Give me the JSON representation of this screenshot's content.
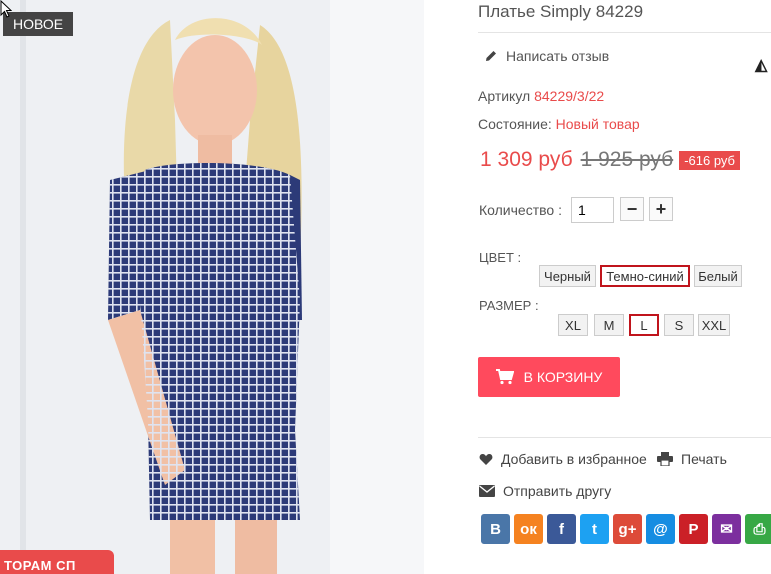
{
  "product": {
    "badge_new": "НОВОЕ",
    "promo_text": "ТОРАМ СП",
    "title": "Платье Simply 84229",
    "review_link": "Написать отзыв",
    "sku_label": "Артикул",
    "sku_value": "84229/3/22",
    "condition_label": "Состояние:",
    "condition_value": "Новый товар",
    "price_new": "1 309 руб",
    "price_old": "1 925 руб",
    "discount": "-616 руб",
    "qty_label": "Количество :",
    "qty_value": "1",
    "minus": "−",
    "plus": "+"
  },
  "options": {
    "color_label": "ЦВЕТ :",
    "colors": [
      "Черный",
      "Темно-синий",
      "Белый"
    ],
    "selected_color": "Темно-синий",
    "size_label": "РАЗМЕР :",
    "sizes": [
      "XL",
      "M",
      "L",
      "S",
      "XXL"
    ],
    "selected_size": "L"
  },
  "actions": {
    "cart_label": "В КОРЗИНУ",
    "wishlist_label": "Добавить в избранное",
    "print_label": "Печать",
    "send_friend_label": "Отправить другу"
  },
  "share": {
    "buttons": [
      {
        "icon": "vk-icon",
        "glyph": "В",
        "color": "#4a76a8"
      },
      {
        "icon": "odnoklassniki-icon",
        "glyph": "ок",
        "color": "#f58220"
      },
      {
        "icon": "facebook-icon",
        "glyph": "f",
        "color": "#3b5998"
      },
      {
        "icon": "twitter-icon",
        "glyph": "t",
        "color": "#1da1f2"
      },
      {
        "icon": "google-plus-icon",
        "glyph": "g+",
        "color": "#dd4b39"
      },
      {
        "icon": "mail-at-icon",
        "glyph": "@",
        "color": "#168de2"
      },
      {
        "icon": "pinterest-icon",
        "glyph": "P",
        "color": "#cb2027"
      },
      {
        "icon": "email-icon",
        "glyph": "✉",
        "color": "#7c2f9e"
      },
      {
        "icon": "print-share-icon",
        "glyph": "⎙",
        "color": "#37a845"
      }
    ]
  },
  "colors": {
    "accent": "#e94b4b",
    "cart_button": "#ff4a5d",
    "selected_border": "#c0141c"
  }
}
